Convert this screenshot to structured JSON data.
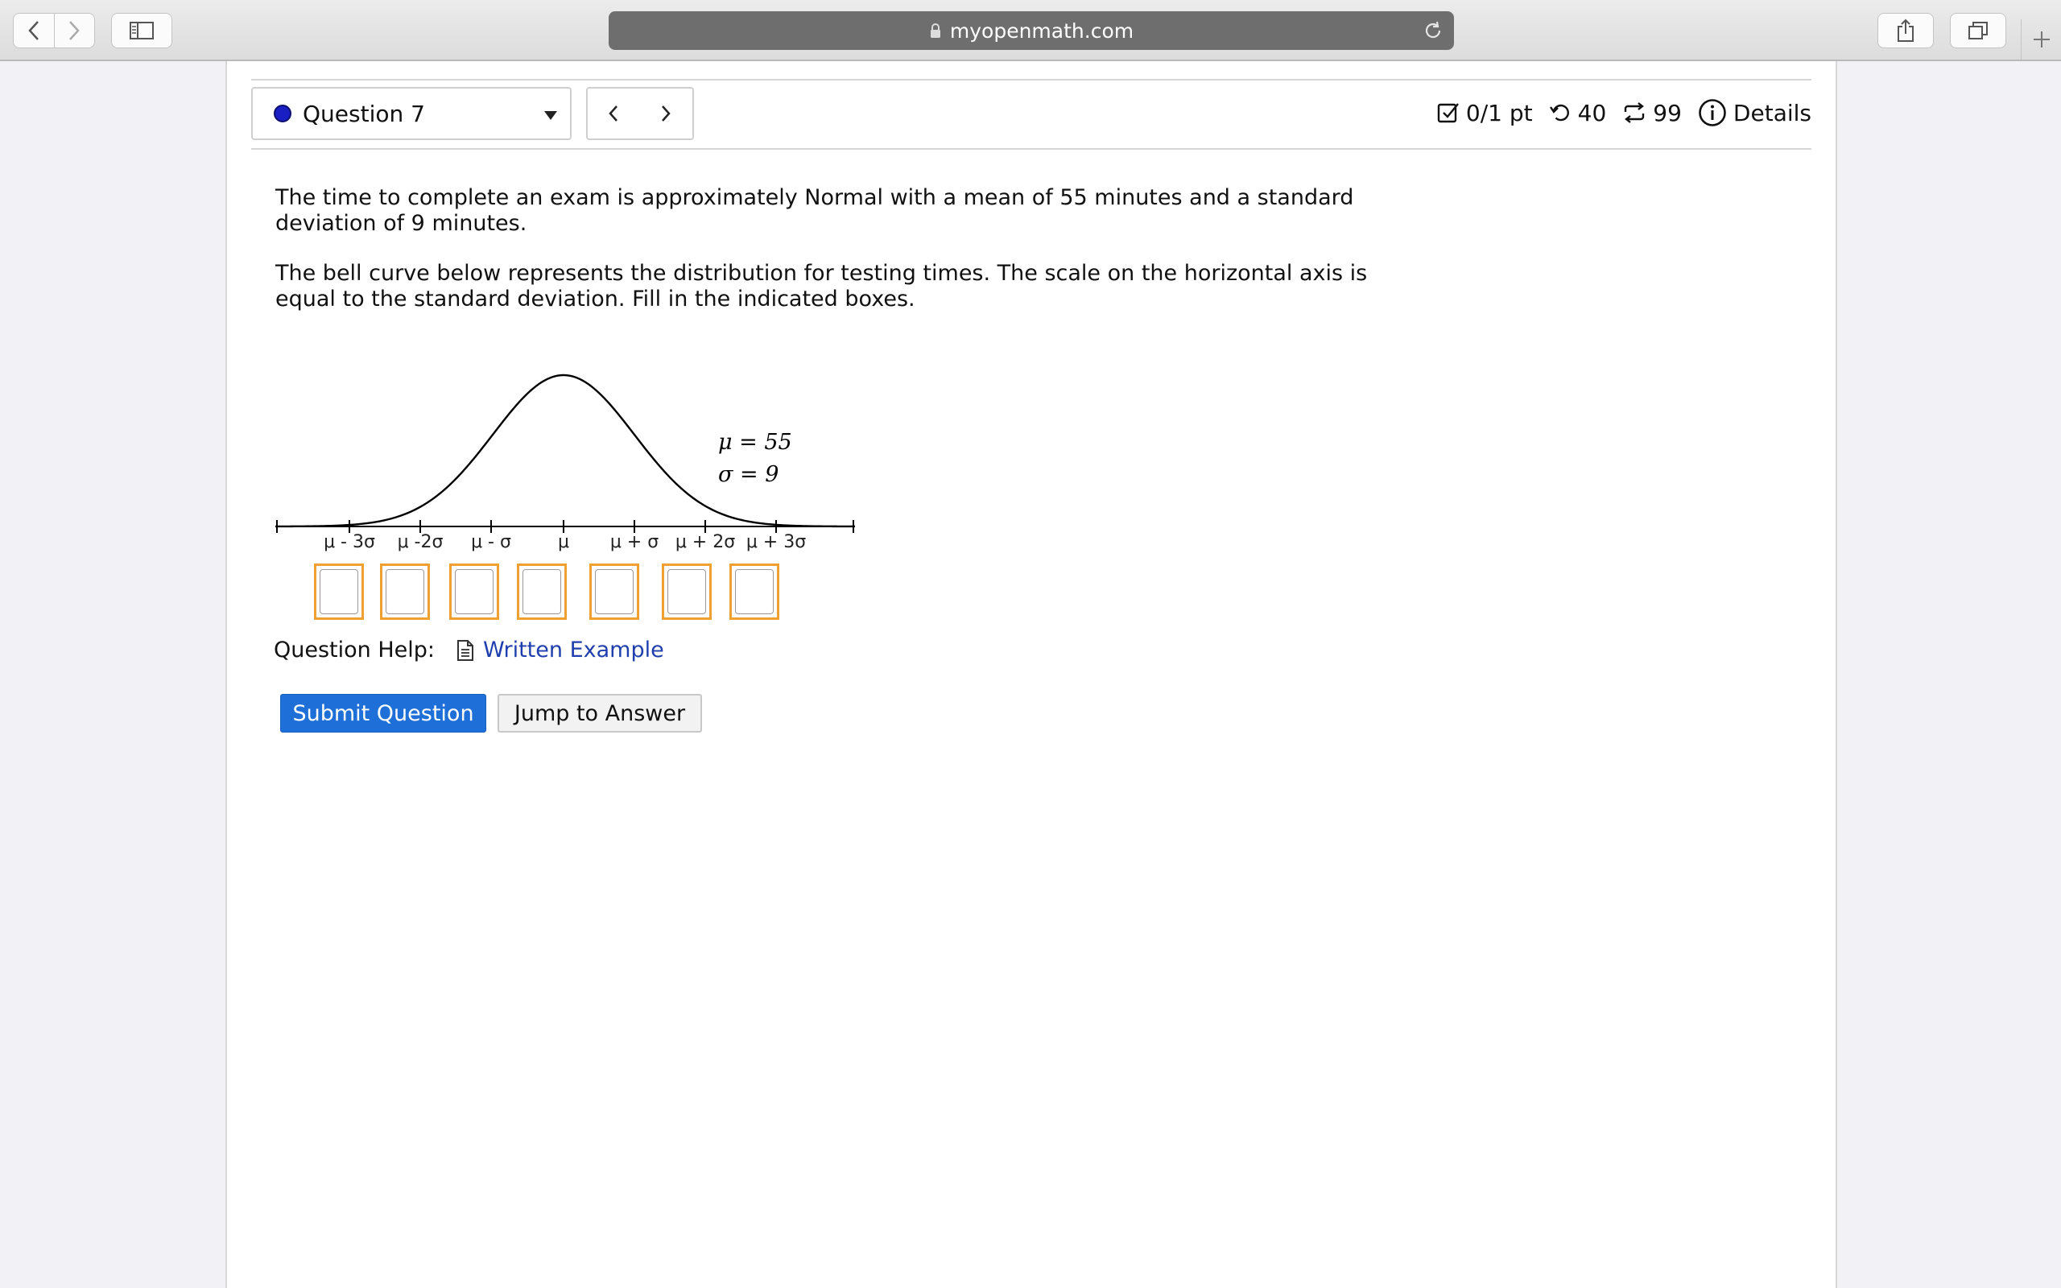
{
  "browser": {
    "url": "myopenmath.com"
  },
  "header": {
    "question_label": "Question 7",
    "status_color": "#1a1fc4",
    "score": "0/1 pt",
    "retries": "40",
    "attempts": "99",
    "details_label": "Details"
  },
  "question": {
    "paragraph1": "The time to complete an exam is approximately Normal with a mean of 55 minutes and a standard deviation of 9 minutes.",
    "paragraph2": "The bell curve below represents the distribution for testing times. The scale on the horizontal axis is equal to the standard deviation. Fill in the indicated boxes."
  },
  "graph": {
    "mu_label": "μ = 55",
    "sigma_label": "σ = 9",
    "tick_labels": [
      "μ - 3σ",
      "μ -2σ",
      "μ - σ",
      "μ",
      "μ + σ",
      "μ + 2σ",
      "μ + 3σ"
    ]
  },
  "answers": [
    "",
    "",
    "",
    "",
    "",
    "",
    ""
  ],
  "help": {
    "label": "Question Help:",
    "link": "Written Example"
  },
  "buttons": {
    "submit": "Submit Question",
    "jump": "Jump to Answer"
  },
  "colors": {
    "accent": "#1f6fd8",
    "highlight_box": "#f0a030",
    "link": "#1f3fae"
  }
}
